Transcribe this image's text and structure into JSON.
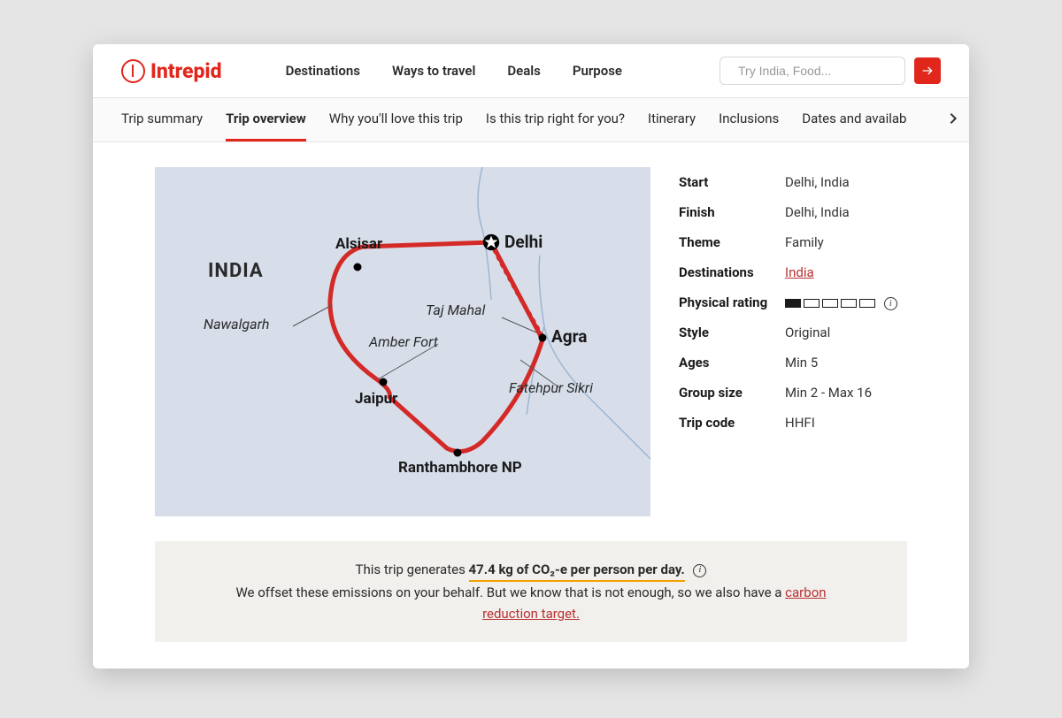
{
  "brand": "Intrepid",
  "main_nav": [
    "Destinations",
    "Ways to travel",
    "Deals",
    "Purpose"
  ],
  "search": {
    "placeholder": "Try India, Food..."
  },
  "sub_nav": {
    "items": [
      "Trip summary",
      "Trip overview",
      "Why you'll love this trip",
      "Is this trip right for you?",
      "Itinerary",
      "Inclusions",
      "Dates and availab"
    ],
    "active_index": 1
  },
  "map": {
    "country": "INDIA",
    "cities": {
      "delhi": "Delhi",
      "alsisar": "Alsisar",
      "agra": "Agra",
      "jaipur": "Jaipur",
      "ranthambhore": "Ranthambhore NP"
    },
    "landmarks": {
      "nawalgarh": "Nawalgarh",
      "amber_fort": "Amber Fort",
      "taj_mahal": "Taj Mahal",
      "fatehpur_sikri": "Fatehpur Sikri"
    }
  },
  "details": {
    "start": {
      "label": "Start",
      "value": "Delhi, India"
    },
    "finish": {
      "label": "Finish",
      "value": "Delhi, India"
    },
    "theme": {
      "label": "Theme",
      "value": "Family"
    },
    "destinations": {
      "label": "Destinations",
      "link": "India"
    },
    "physical": {
      "label": "Physical rating",
      "level": 1,
      "max": 5
    },
    "style": {
      "label": "Style",
      "value": "Original"
    },
    "ages": {
      "label": "Ages",
      "value": "Min 5"
    },
    "group_size": {
      "label": "Group size",
      "value": "Min 2 - Max 16"
    },
    "trip_code": {
      "label": "Trip code",
      "value": "HHFI"
    }
  },
  "carbon": {
    "prefix": "This trip generates ",
    "highlight": "47.4 kg of CO₂-e per person per day.",
    "offset_text": "We offset these emissions on your behalf. But we know that is not enough, so we also have a ",
    "link": "carbon reduction target."
  }
}
